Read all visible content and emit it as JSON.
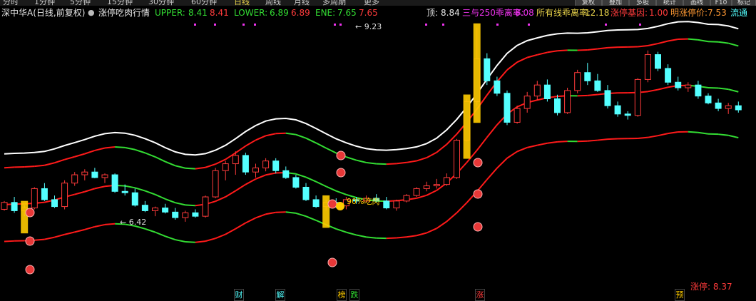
{
  "top_tabs": [
    {
      "label": "分时"
    },
    {
      "label": "1分钟"
    },
    {
      "label": "5分钟"
    },
    {
      "label": "15分钟"
    },
    {
      "label": "30分钟"
    },
    {
      "label": "60分钟"
    },
    {
      "label": "日线"
    },
    {
      "label": "周线"
    },
    {
      "label": "月线"
    },
    {
      "label": "多周期"
    },
    {
      "label": "更多"
    }
  ],
  "right_buttons": [
    {
      "label": "复权"
    },
    {
      "label": "叠加"
    },
    {
      "label": "多股"
    },
    {
      "label": "统计"
    },
    {
      "label": "画线"
    },
    {
      "label": "F10"
    },
    {
      "label": "标记"
    }
  ],
  "header": {
    "title": "深中华A(日线,前复权)",
    "indicator_name": "涨停吃肉行情",
    "upper_label": "UPPER:",
    "upper_value": "8.41",
    "upper_value2": "8.41",
    "lower_label": "LOWER:",
    "lower_value": "6.89",
    "lower_value2": "6.89",
    "ene_label": "ENE:",
    "ene_value": "7.65",
    "ene_value2": "7.65",
    "top_label": "顶:",
    "top_value": "8.84",
    "ratio250_label": "三与250乖离率:",
    "ratio250_value": "8.08",
    "allline_label": "所有线乖离率:",
    "allline_value": "12.18",
    "gene_label": "涨停基因:",
    "gene_value": "1.00",
    "tomorrow_label": "明涨停价:",
    "tomorrow_value": "7.53",
    "flow_label": "流通"
  },
  "colors": {
    "up": "#ff3b3b",
    "down": "#54ffff",
    "red_line": "#ff1a1a",
    "green_line": "#33dd33",
    "white_line": "#ffffff",
    "yellow_bar": "#ffcc00",
    "label_green": "#33dd33"
  },
  "chart_data": {
    "type": "candlestick",
    "y_range": [
      5.5,
      9.3
    ],
    "bars": 74,
    "grid": false,
    "series": [
      {
        "name": "UPPER",
        "color": "red/green",
        "values": []
      },
      {
        "name": "ENE",
        "color": "red/green",
        "values": []
      },
      {
        "name": "LOWER",
        "color": "red/green",
        "values": []
      },
      {
        "name": "顶",
        "color": "white",
        "values": []
      }
    ],
    "candles": [
      [
        6.6,
        6.72,
        6.58,
        6.7
      ],
      [
        6.7,
        6.78,
        6.55,
        6.58
      ],
      [
        6.58,
        6.66,
        6.5,
        6.62
      ],
      [
        6.62,
        6.92,
        6.6,
        6.9
      ],
      [
        6.9,
        6.98,
        6.72,
        6.74
      ],
      [
        6.74,
        6.8,
        6.62,
        6.64
      ],
      [
        6.64,
        7.02,
        6.6,
        6.98
      ],
      [
        6.98,
        7.14,
        6.94,
        7.1
      ],
      [
        7.1,
        7.18,
        7.02,
        7.14
      ],
      [
        7.14,
        7.2,
        7.05,
        7.06
      ],
      [
        7.06,
        7.12,
        6.98,
        7.1
      ],
      [
        7.1,
        7.12,
        6.84,
        6.86
      ],
      [
        6.86,
        6.96,
        6.8,
        6.84
      ],
      [
        6.84,
        6.9,
        6.64,
        6.66
      ],
      [
        6.66,
        6.72,
        6.56,
        6.58
      ],
      [
        6.58,
        6.64,
        6.5,
        6.62
      ],
      [
        6.62,
        6.68,
        6.54,
        6.56
      ],
      [
        6.56,
        6.62,
        6.45,
        6.48
      ],
      [
        6.48,
        6.58,
        6.42,
        6.55
      ],
      [
        6.55,
        6.6,
        6.48,
        6.5
      ],
      [
        6.5,
        6.8,
        6.48,
        6.78
      ],
      [
        6.78,
        7.2,
        6.76,
        7.16
      ],
      [
        7.16,
        7.3,
        7.02,
        7.26
      ],
      [
        7.26,
        7.44,
        7.1,
        7.38
      ],
      [
        7.38,
        7.42,
        7.1,
        7.14
      ],
      [
        7.14,
        7.26,
        7.06,
        7.2
      ],
      [
        7.2,
        7.34,
        7.15,
        7.3
      ],
      [
        7.3,
        7.34,
        7.12,
        7.16
      ],
      [
        7.16,
        7.22,
        7.04,
        7.06
      ],
      [
        7.06,
        7.1,
        6.9,
        6.92
      ],
      [
        6.92,
        6.98,
        6.72,
        6.74
      ],
      [
        6.74,
        6.8,
        6.62,
        6.64
      ],
      [
        6.64,
        6.74,
        6.58,
        6.7
      ],
      [
        6.7,
        6.76,
        6.62,
        6.65
      ],
      [
        6.65,
        6.78,
        6.6,
        6.74
      ],
      [
        6.74,
        6.78,
        6.68,
        6.72
      ],
      [
        6.72,
        6.8,
        6.7,
        6.76
      ],
      [
        6.76,
        6.82,
        6.7,
        6.72
      ],
      [
        6.72,
        6.78,
        6.6,
        6.62
      ],
      [
        6.62,
        6.74,
        6.58,
        6.72
      ],
      [
        6.72,
        6.82,
        6.7,
        6.8
      ],
      [
        6.8,
        6.92,
        6.78,
        6.9
      ],
      [
        6.9,
        7.0,
        6.86,
        6.94
      ],
      [
        6.94,
        7.04,
        6.9,
        6.96
      ],
      [
        6.96,
        7.12,
        6.94,
        7.06
      ],
      [
        7.06,
        7.62,
        7.04,
        7.6
      ],
      [
        7.6,
        8.2,
        7.58,
        8.16
      ],
      [
        8.16,
        9.23,
        8.1,
        8.78
      ],
      [
        8.78,
        8.86,
        8.4,
        8.46
      ],
      [
        8.46,
        8.52,
        8.24,
        8.28
      ],
      [
        8.28,
        8.32,
        7.82,
        7.86
      ],
      [
        7.86,
        8.1,
        7.84,
        8.06
      ],
      [
        8.06,
        8.3,
        8.0,
        8.24
      ],
      [
        8.24,
        8.46,
        8.18,
        8.4
      ],
      [
        8.4,
        8.48,
        8.16,
        8.2
      ],
      [
        8.2,
        8.26,
        7.96,
        8.0
      ],
      [
        8.0,
        8.36,
        7.98,
        8.32
      ],
      [
        8.32,
        8.62,
        8.28,
        8.58
      ],
      [
        8.58,
        8.72,
        8.4,
        8.46
      ],
      [
        8.46,
        8.56,
        8.3,
        8.32
      ],
      [
        8.32,
        8.4,
        8.06,
        8.1
      ],
      [
        8.1,
        8.16,
        7.94,
        7.98
      ],
      [
        7.98,
        8.02,
        7.9,
        7.96
      ],
      [
        7.96,
        8.5,
        7.94,
        8.48
      ],
      [
        8.48,
        8.9,
        8.44,
        8.84
      ],
      [
        8.84,
        8.88,
        8.6,
        8.64
      ],
      [
        8.64,
        8.7,
        8.4,
        8.44
      ],
      [
        8.44,
        8.52,
        8.32,
        8.36
      ],
      [
        8.36,
        8.44,
        8.3,
        8.4
      ],
      [
        8.4,
        8.46,
        8.2,
        8.24
      ],
      [
        8.24,
        8.28,
        8.12,
        8.14
      ],
      [
        8.14,
        8.2,
        8.02,
        8.06
      ],
      [
        8.06,
        8.14,
        7.98,
        8.1
      ],
      [
        8.1,
        8.16,
        8.0,
        8.04
      ]
    ],
    "annotations": [
      {
        "text": "9.23",
        "kind": "high"
      },
      {
        "text": "6.42",
        "kind": "low"
      },
      {
        "text": "90%吃肉",
        "kind": "signal"
      }
    ],
    "bottom_markers": [
      {
        "text": "财",
        "color": "#54ffff",
        "bar": 20
      },
      {
        "text": "解",
        "color": "#54ffff",
        "bar": 24
      },
      {
        "text": "榜",
        "color": "#ffcc00",
        "bar": 29
      },
      {
        "text": "跌",
        "color": "#33dd33",
        "bar": 30
      },
      {
        "text": "涨",
        "color": "#ff3b3b",
        "bar": 43
      },
      {
        "text": "预",
        "color": "#ffcc00",
        "bar": 62
      }
    ]
  },
  "footer": {
    "limit_up_label": "涨停:",
    "limit_up_value": "8.37"
  }
}
